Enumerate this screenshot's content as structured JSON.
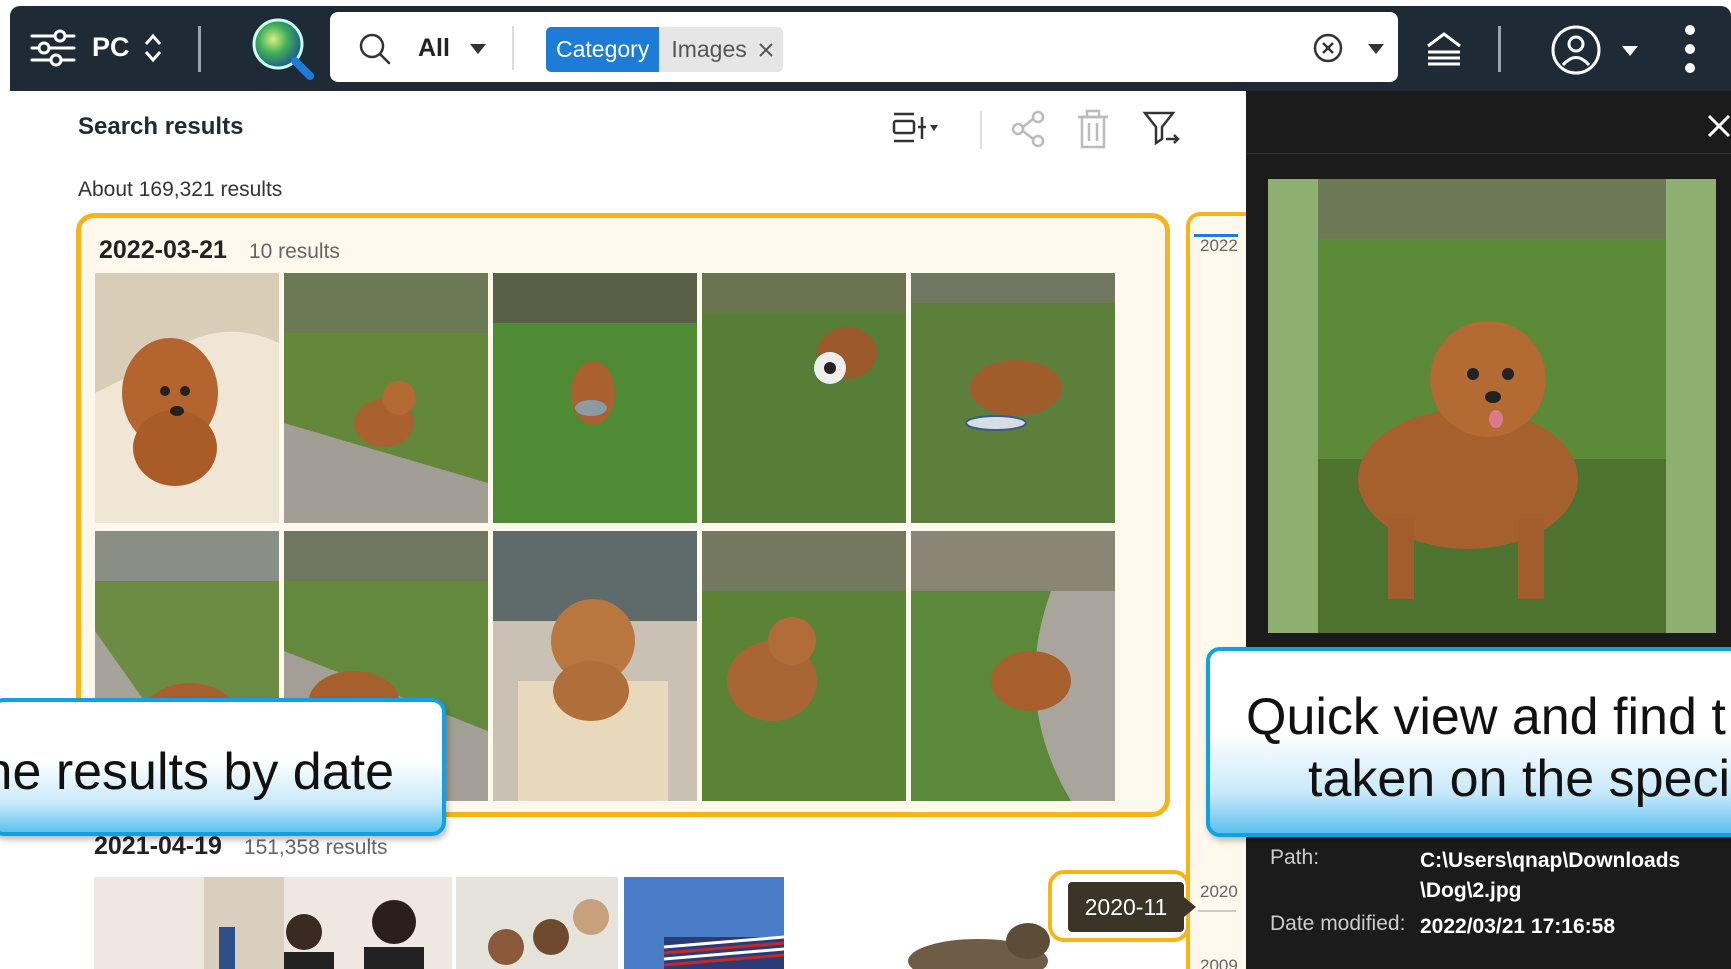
{
  "topbar": {
    "device_label": "PC",
    "search_scope": "All",
    "filter_chip": {
      "key": "Category",
      "value": "Images"
    }
  },
  "results": {
    "title": "Search results",
    "count_text": "About 169,321 results",
    "groups": [
      {
        "date": "2022-03-21",
        "count": "10 results"
      },
      {
        "date": "2021-04-19",
        "count": "151,358 results"
      }
    ]
  },
  "timeline": {
    "years": [
      "2022",
      "2020",
      "2009"
    ],
    "tooltip": "2020-11"
  },
  "preview": {
    "path_label": "Path:",
    "path_value_line1": "C:\\Users\\qnap\\Downloads",
    "path_value_line2": "\\Dog\\2.jpg",
    "modified_label": "Date modified:",
    "modified_value": "2022/03/21 17:16:58"
  },
  "callouts": {
    "left": "ne results by date",
    "right_line1": "Quick view and find t",
    "right_line2": "taken on the speci"
  },
  "colors": {
    "topbar": "#1f2a37",
    "chip_key": "#1e7bd8",
    "highlight_border": "#f4b41a",
    "callout_border": "#0ea2e2",
    "preview_bg": "#1b1b1b"
  }
}
